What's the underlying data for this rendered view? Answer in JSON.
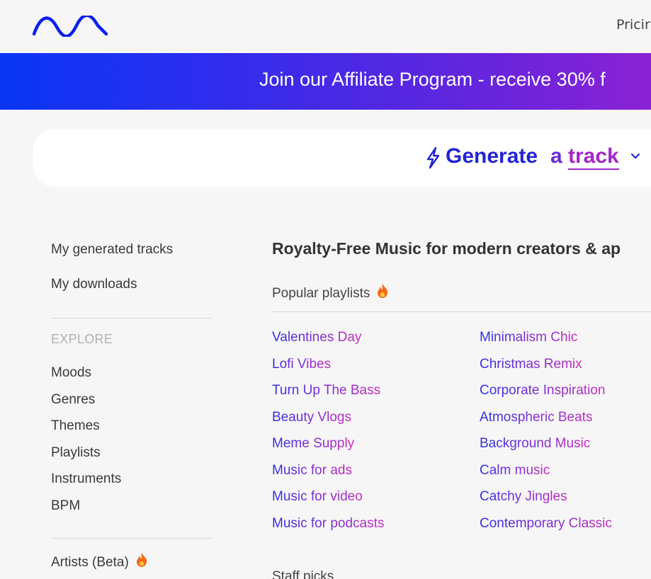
{
  "header": {
    "nav_pricing": "Pricir"
  },
  "banner": {
    "text": "Join our Affiliate Program - receive 30% f"
  },
  "generate": {
    "word_generate": "Generate",
    "word_a": "a",
    "word_track": "track"
  },
  "sidebar": {
    "my_generated_tracks": "My generated tracks",
    "my_downloads": "My downloads",
    "explore_heading": "EXPLORE",
    "explore_items": [
      "Moods",
      "Genres",
      "Themes",
      "Playlists",
      "Instruments",
      "BPM"
    ],
    "artists": "Artists (Beta)"
  },
  "main": {
    "title": "Royalty-Free Music for modern creators & ap",
    "popular_label": "Popular playlists",
    "playlists_col1": [
      "Valentines Day",
      "Lofi Vibes",
      "Turn Up The Bass",
      "Beauty Vlogs",
      "Meme Supply",
      "Music for ads",
      "Music for video",
      "Music for podcasts"
    ],
    "playlists_col2": [
      "Minimalism Chic",
      "Christmas Remix",
      "Corporate Inspiration",
      "Atmospheric Beats",
      "Background Music",
      "Calm music",
      "Catchy Jingles",
      "Contemporary Classic"
    ],
    "staff_picks": "Staff picks"
  },
  "icons": {
    "logo": "wave-logo-icon",
    "bolt": "lightning-bolt-icon",
    "chevron": "chevron-down-icon",
    "fire": "fire-icon"
  },
  "colors": {
    "brand_blue": "#0a36f5",
    "brand_purple": "#8a22d4",
    "link_gradient_start": "#2d2fe0",
    "link_gradient_end": "#c52cbd"
  }
}
